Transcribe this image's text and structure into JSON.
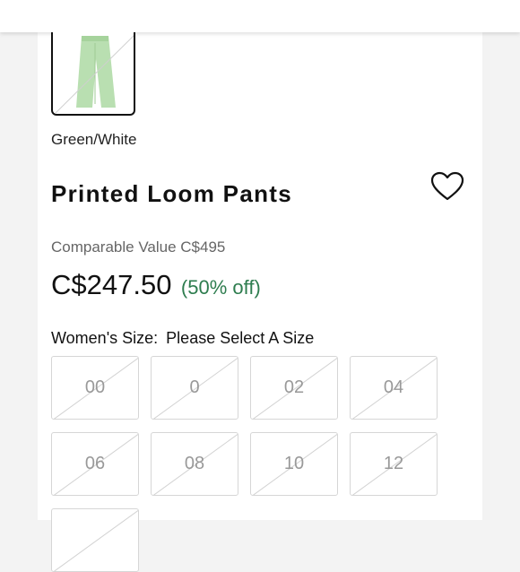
{
  "product": {
    "color_name": "Green/White",
    "title": "Printed Loom Pants",
    "comparable_value": "Comparable Value C$495",
    "price": "C$247.50",
    "discount": "(50% off)",
    "accent_color": "#2e7d4f"
  },
  "size_selector": {
    "label": "Women's Size:",
    "prompt": "Please Select A Size",
    "sizes": [
      "00",
      "0",
      "02",
      "04",
      "06",
      "08",
      "10",
      "12"
    ],
    "all_unavailable": true
  },
  "icons": {
    "favorite": "heart-icon"
  }
}
